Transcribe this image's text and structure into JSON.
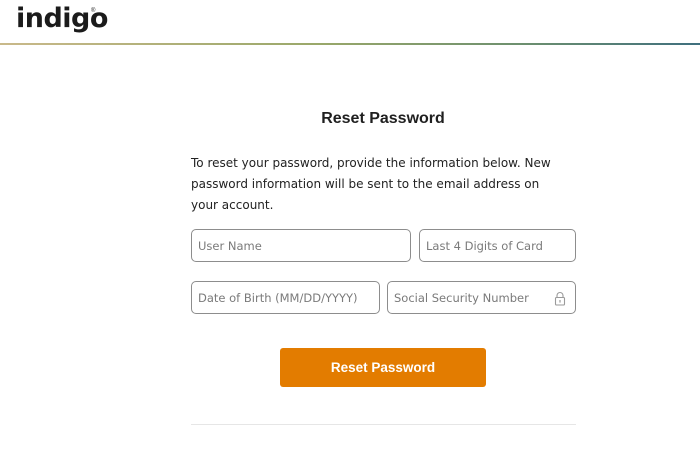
{
  "header": {
    "logo_text": "indigo",
    "logo_mark": "®"
  },
  "form": {
    "title": "Reset Password",
    "intro": "To reset your password, provide the information below. New password information will be sent to the email address on your account.",
    "fields": {
      "username_placeholder": "User Name",
      "card_placeholder": "Last 4 Digits of Card",
      "dob_placeholder": "Date of Birth (MM/DD/YYYY)",
      "ssn_placeholder": "Social Security Number"
    },
    "ssn_icon": "lock-icon",
    "submit_label": "Reset Password"
  },
  "colors": {
    "accent": "#e37c00",
    "field_border": "#8d8d8d"
  }
}
